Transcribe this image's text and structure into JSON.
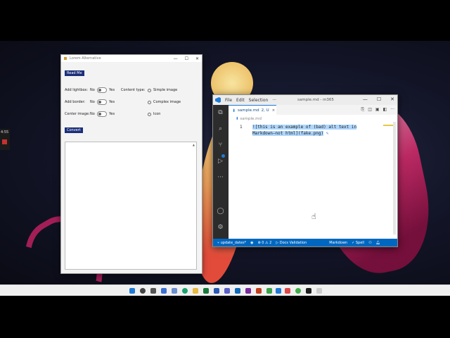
{
  "side_panel": {
    "badge": "4:55"
  },
  "lorem_window": {
    "title": "Lorem Alternative",
    "controls": {
      "minimize": "—",
      "maximize": "☐",
      "close": "✕"
    },
    "read_me_button": "Read Me",
    "rows": [
      {
        "label": "Add lightbox:",
        "no": "No",
        "yes": "Yes"
      },
      {
        "label": "Add border:",
        "no": "No",
        "yes": "Yes"
      },
      {
        "label": "Center image:",
        "no": "No",
        "yes": "Yes"
      }
    ],
    "content_type_label": "Content type:",
    "content_types": [
      "Simple image",
      "Complex image",
      "Icon"
    ],
    "convert_button": "Convert",
    "output": {
      "scroll_up": "▲"
    }
  },
  "vscode": {
    "menu": [
      "File",
      "Edit",
      "Selection",
      "···"
    ],
    "window_title": "sample.md - m365",
    "controls": {
      "minimize": "—",
      "maximize": "☐",
      "close": "✕"
    },
    "tab": {
      "name": "sample.md",
      "status": "2, U",
      "close": "×"
    },
    "breadcrumb": "sample.md",
    "line_number": "1",
    "code_line1": "![this is an example of (bad) alt text in",
    "code_line2": "Markdown—not html](fake.png)",
    "statusbar": {
      "branch": "update_dates*",
      "errors": "⊗ 0 ⚠ 2",
      "docs": "Docs Validation",
      "language": "Markdown",
      "spell": "✓ Spell"
    }
  }
}
